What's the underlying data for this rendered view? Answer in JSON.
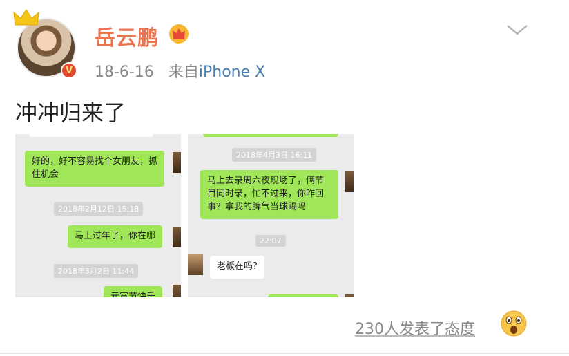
{
  "post": {
    "username": "岳云鹏",
    "date": "18-6-16",
    "source_prefix": "来自",
    "device": "iPhone X",
    "text": "冲冲归来了"
  },
  "screenshot_left": {
    "bubble_1": "好的，好不容易找个女朋友，抓住机会",
    "time_1": "2018年2月12日 15:18",
    "bubble_2": "马上过年了，你在哪",
    "time_2": "2018年3月2日 11:44",
    "bubble_3": "元宵节快乐"
  },
  "screenshot_right": {
    "time_1": "2018年4月3日 16:11",
    "bubble_1": "马上去录周六夜现场了，俩节目同时录，忙不过来，你咋回事？拿我的脾气当球踢吗",
    "time_2": "22:07",
    "bubble_2": "老板在吗?"
  },
  "footer": {
    "reactions_text": "230人发表了态度"
  },
  "icons": {
    "avatar_crown": "crown-icon",
    "verified": "verified-badge-icon",
    "vip": "vip-crown-icon",
    "menu": "chevron-down-icon",
    "reaction": "shocked-face-icon"
  },
  "colors": {
    "username": "#eb7350",
    "device_link": "#4a7fb5",
    "chat_green": "#9fe658",
    "verified_red": "#e3492e"
  }
}
